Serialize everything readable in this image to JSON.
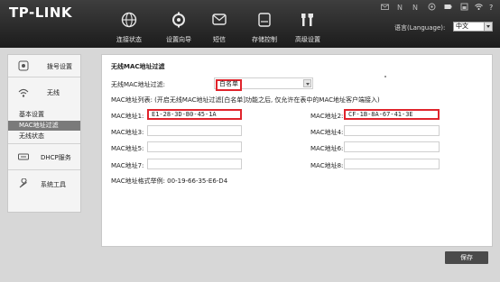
{
  "header": {
    "logo": "TP-LINK",
    "nav": [
      {
        "label": "连接状态",
        "icon": "globe-icon"
      },
      {
        "label": "设置向导",
        "icon": "wizard-icon"
      },
      {
        "label": "短信",
        "icon": "message-icon"
      },
      {
        "label": "存储控制",
        "icon": "storage-icon"
      },
      {
        "label": "高级设置",
        "icon": "advanced-settings-icon"
      }
    ],
    "status_icons": [
      "mail-icon",
      "signal-n-icon",
      "signal-n2-icon",
      "sd-card-icon",
      "battery-icon",
      "wifi-icon",
      "help-icon"
    ],
    "language_label": "语言(Language):",
    "language_value": "中文"
  },
  "sidebar": {
    "items": [
      {
        "label": "拨号设置",
        "icon": "dial-icon"
      },
      {
        "label": "无线",
        "icon": "wifi-icon"
      },
      {
        "label": "DHCP服务",
        "icon": "dhcp-icon"
      },
      {
        "label": "系统工具",
        "icon": "tools-icon"
      }
    ],
    "subitems": [
      {
        "label": "基本设置"
      },
      {
        "label": "MAC地址过滤"
      },
      {
        "label": "无线状态"
      }
    ]
  },
  "main": {
    "title": "无线MAC地址过滤",
    "filter_label": "无线MAC地址过滤:",
    "filter_value": "白名单",
    "list_note": "MAC地址列表: (开启无线MAC地址过滤[白名单]功能之后, 仅允许在表中的MAC地址客户端接入)",
    "mac_rows": [
      {
        "label1": "MAC地址1:",
        "value1": "E1-28-3D-B0-45-1A",
        "label2": "MAC地址2:",
        "value2": "CF-1B-8A-67-41-3E"
      },
      {
        "label1": "MAC地址3:",
        "value1": "",
        "label2": "MAC地址4:",
        "value2": ""
      },
      {
        "label1": "MAC地址5:",
        "value1": "",
        "label2": "MAC地址6:",
        "value2": ""
      },
      {
        "label1": "MAC地址7:",
        "value1": "",
        "label2": "MAC地址8:",
        "value2": ""
      }
    ],
    "format_example": "MAC地址格式举例: 00-19-66-35-E6-D4"
  },
  "footer": {
    "save_label": "保存"
  },
  "colors": {
    "highlight": "#e0242c",
    "active_submenu": "#7a7a7a",
    "header_bg": "#2a2a2a"
  }
}
